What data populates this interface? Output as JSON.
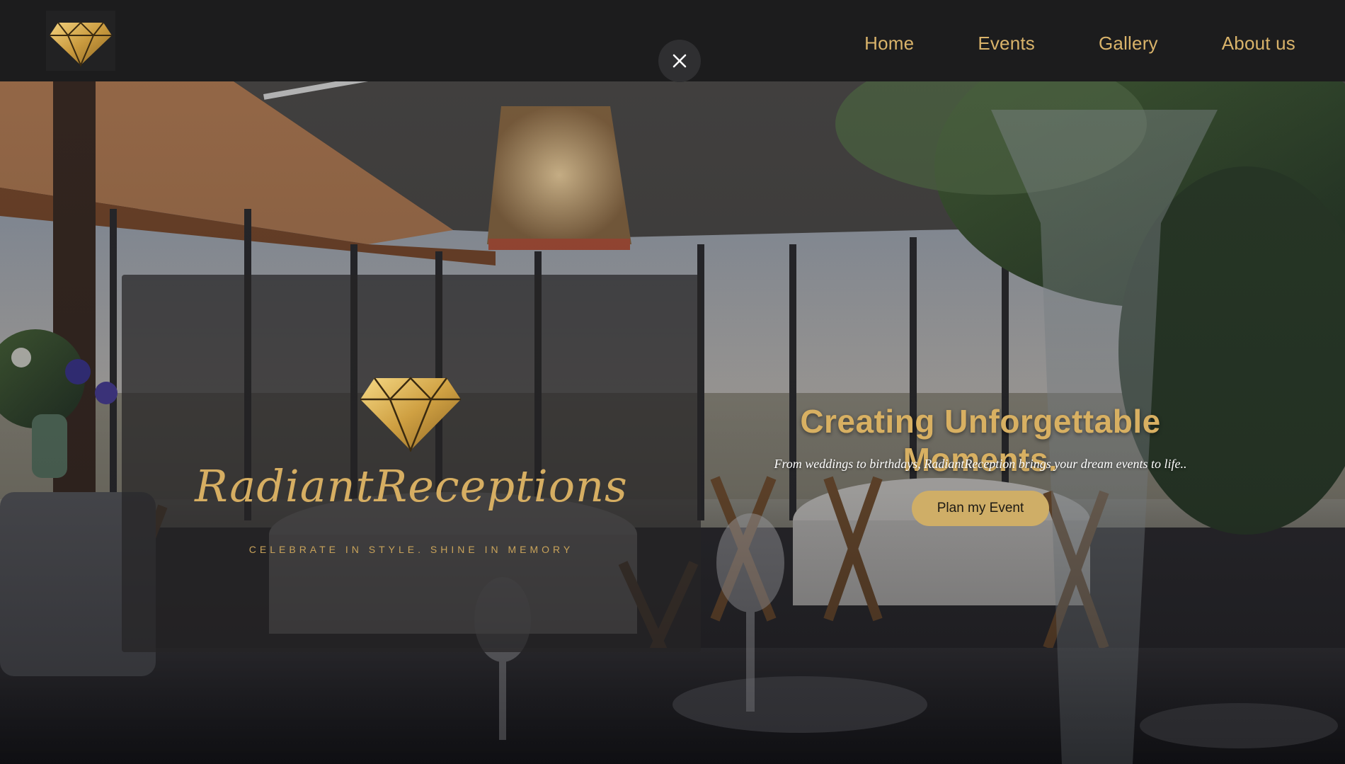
{
  "header": {
    "logo_icon": "gold-diamond-icon",
    "close_icon": "close-icon",
    "nav": [
      {
        "label": "Home"
      },
      {
        "label": "Events"
      },
      {
        "label": "Gallery"
      },
      {
        "label": "About us"
      }
    ]
  },
  "brand": {
    "name": "RadiantReceptions",
    "tagline": "CELEBRATE IN STYLE. SHINE IN MEMORY",
    "diamond_icon": "gold-diamond-icon"
  },
  "hero": {
    "title": "Creating Unforgettable Moments.",
    "subtitle": "From weddings to birthdays, RadiantReception brings your dream events to life..",
    "cta_label": "Plan my Event"
  },
  "colors": {
    "header_bg": "#1c1c1d",
    "accent_gold": "#d8b062",
    "cta_bg": "#cfae67",
    "card_bg": "#262426"
  }
}
